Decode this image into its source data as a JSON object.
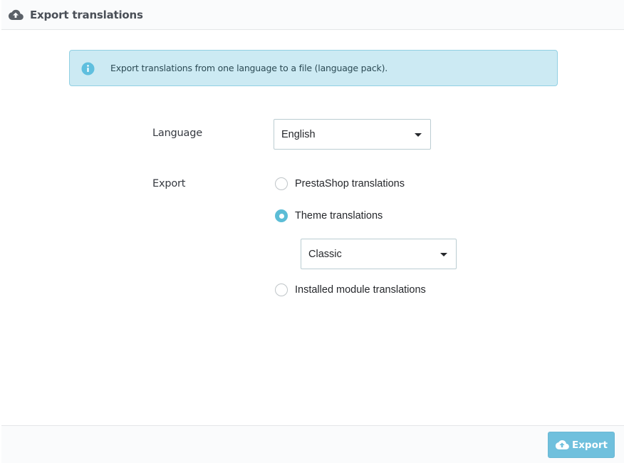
{
  "header": {
    "title": "Export translations",
    "icon": "cloud-upload-icon"
  },
  "alert": {
    "icon": "info-icon",
    "text": "Export translations from one language to a file (language pack).",
    "color_bg": "#cceaf3",
    "color_border": "#92d0e3"
  },
  "form": {
    "language_label": "Language",
    "language_value": "English",
    "export_label": "Export",
    "options": [
      {
        "label": "PrestaShop translations",
        "checked": false
      },
      {
        "label": "Theme translations",
        "checked": true
      },
      {
        "label": "Installed module translations",
        "checked": false
      }
    ],
    "theme_value": "Classic"
  },
  "footer": {
    "export_button_label": "Export",
    "export_button_icon": "cloud-upload-icon",
    "accent_color": "#70c0dd"
  }
}
